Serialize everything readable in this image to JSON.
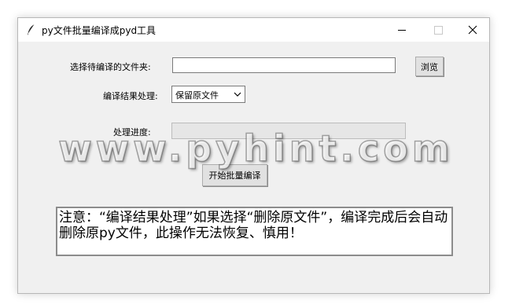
{
  "window": {
    "title": "py文件批量编译成pyd工具"
  },
  "icons": {
    "app": "feather-icon",
    "minimize": "minimize-icon",
    "maximize": "maximize-icon",
    "close": "close-icon",
    "dropdown": "chevron-down-icon"
  },
  "form": {
    "folder_label": "选择待编译的文件夹:",
    "folder_value": "",
    "browse_label": "浏览",
    "result_label": "编译结果处理:",
    "result_selected": "保留原文件",
    "progress_label": "处理进度:",
    "progress_value": 0,
    "start_label": "开始批量编译"
  },
  "notice": {
    "text": "注意：“编译结果处理”如果选择“删除原文件”，编译完成后会自动删除原py文件，此操作无法恢复、慎用！"
  },
  "watermark": {
    "text": "www.pyhint.com"
  }
}
